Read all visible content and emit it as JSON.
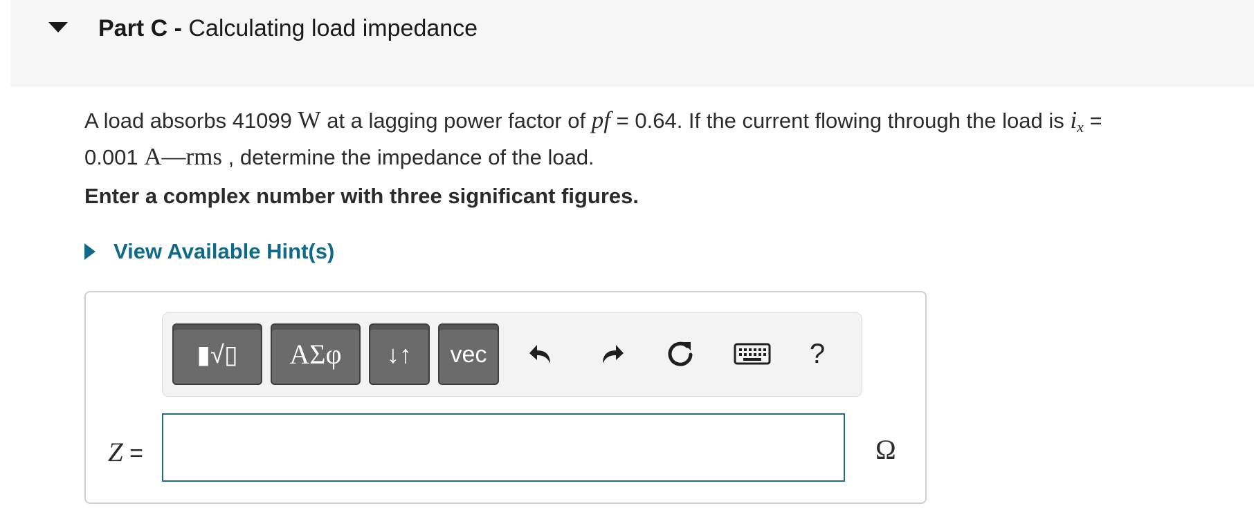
{
  "part": {
    "label": "Part C",
    "separator": "-",
    "title": "Calculating load impedance"
  },
  "problem": {
    "t1": "A load absorbs 41099",
    "unit_w": "W",
    "t2": "at a lagging power factor of",
    "pf_symbol": "pf",
    "t3": "= 0.64. If the current flowing through the load is",
    "i_symbol": "i",
    "i_sub": "x",
    "t4": "=",
    "t5": "0.001",
    "unit_a": "A",
    "unit_dash": "—",
    "unit_rms": "rms",
    "t6": ", determine the impedance of the load."
  },
  "instruction": "Enter a complex number with three significant figures.",
  "hint": {
    "label": "View Available Hint(s)"
  },
  "toolbar": {
    "templates_glyph": "▮√▯",
    "greek_glyph": "ΑΣφ",
    "arrows_glyph": "↓↑",
    "vec_label": "vec",
    "undo_icon": "undo-icon",
    "redo_icon": "redo-icon",
    "reset_icon": "reset-icon",
    "keyboard_icon": "keyboard-icon",
    "help_label": "?"
  },
  "answer": {
    "variable": "Z",
    "equals": "=",
    "value": "",
    "unit": "Ω"
  }
}
